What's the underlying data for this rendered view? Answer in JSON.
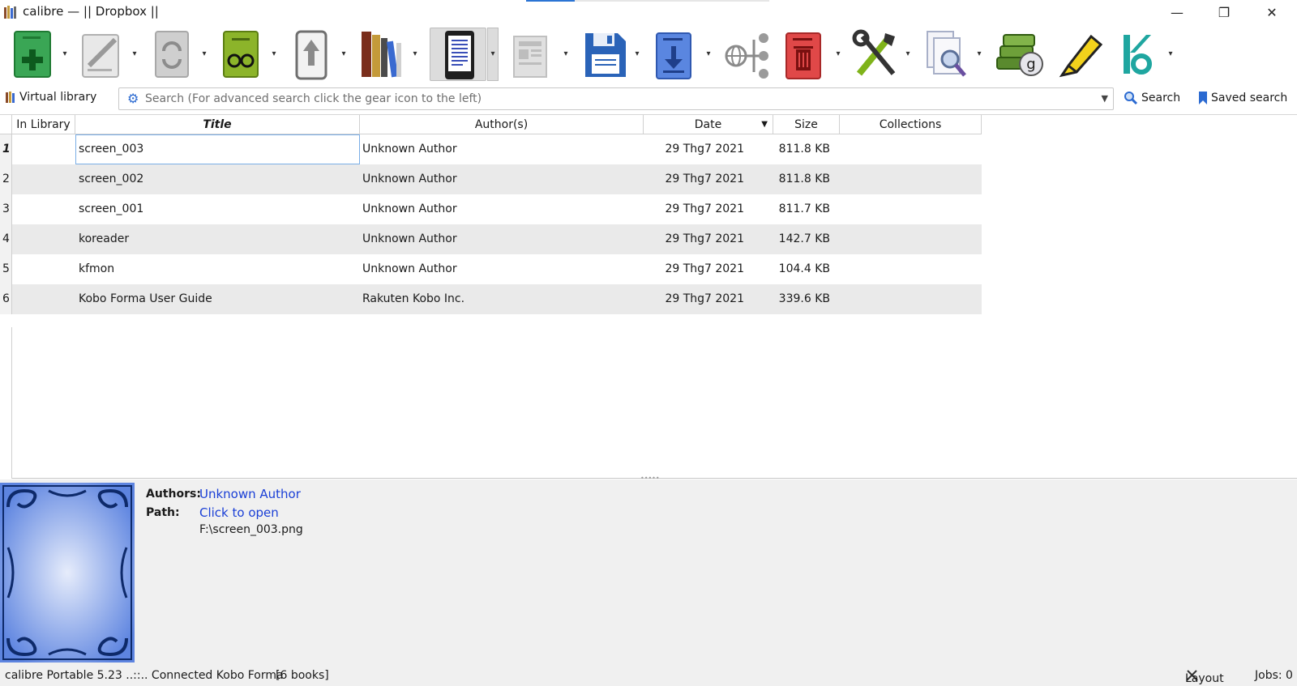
{
  "window": {
    "title": "calibre — || Dropbox ||",
    "minimize_glyph": "—",
    "restore_glyph": "❐",
    "close_glyph": "✕"
  },
  "toolbar": {
    "items": [
      {
        "name": "add-books",
        "icon": "add-book-icon",
        "color": "#3aa655",
        "has_dropdown": true
      },
      {
        "name": "edit-metadata",
        "icon": "edit-metadata-icon",
        "color": "#bdbdbd",
        "has_dropdown": true
      },
      {
        "name": "convert-books",
        "icon": "convert-icon",
        "color": "#bdbdbd",
        "has_dropdown": true
      },
      {
        "name": "view",
        "icon": "view-book-icon",
        "color": "#7fa824",
        "has_dropdown": true
      },
      {
        "name": "send-to-device",
        "icon": "send-to-device-icon",
        "color": "#9a9a9a",
        "has_dropdown": true
      },
      {
        "name": "calibre-library",
        "icon": "library-icon",
        "color": "#7a2e1c",
        "has_dropdown": true
      },
      {
        "name": "device",
        "icon": "device-icon",
        "color": "#222222",
        "has_dropdown": true,
        "active": true
      },
      {
        "name": "fetch-news",
        "icon": "news-icon",
        "color": "#c8c8c8",
        "has_dropdown": true
      },
      {
        "name": "save-to-disk",
        "icon": "save-icon",
        "color": "#2a63b8",
        "has_dropdown": true
      },
      {
        "name": "get-books",
        "icon": "get-books-icon",
        "color": "#3b6fd0",
        "has_dropdown": true
      },
      {
        "name": "connect-share",
        "icon": "connect-share-icon",
        "color": "#9a9a9a",
        "has_dropdown": false
      },
      {
        "name": "remove-books",
        "icon": "trash-icon",
        "color": "#d23a3a",
        "has_dropdown": true
      },
      {
        "name": "preferences",
        "icon": "tools-icon",
        "color": "#333333",
        "has_dropdown": true
      },
      {
        "name": "find-duplicates",
        "icon": "find-icon",
        "color": "#7b8fb8",
        "has_dropdown": true
      },
      {
        "name": "goodreads",
        "icon": "goodreads-icon",
        "color": "#5a8a2e",
        "has_dropdown": false
      },
      {
        "name": "annotations",
        "icon": "highlighter-icon",
        "color": "#f3d21c",
        "has_dropdown": false
      },
      {
        "name": "kobo-utilities",
        "icon": "kobo-icon",
        "color": "#1fa6a0",
        "has_dropdown": true
      }
    ]
  },
  "search": {
    "virtual_library_label": "Virtual library",
    "placeholder": "Search (For advanced search click the gear icon to the left)",
    "search_label": "Search",
    "saved_search_label": "Saved search"
  },
  "columns": {
    "in_library": "In Library",
    "title": "Title",
    "authors": "Author(s)",
    "date": "Date",
    "size": "Size",
    "collections": "Collections",
    "sort_glyph": "▼"
  },
  "books": [
    {
      "num": "1",
      "title": "screen_003",
      "author": "Unknown Author",
      "date": "29 Thg7 2021",
      "size": "811.8 KB"
    },
    {
      "num": "2",
      "title": "screen_002",
      "author": "Unknown Author",
      "date": "29 Thg7 2021",
      "size": "811.8 KB"
    },
    {
      "num": "3",
      "title": "screen_001",
      "author": "Unknown Author",
      "date": "29 Thg7 2021",
      "size": "811.7 KB"
    },
    {
      "num": "4",
      "title": "koreader",
      "author": "Unknown Author",
      "date": "29 Thg7 2021",
      "size": "142.7 KB"
    },
    {
      "num": "5",
      "title": "kfmon",
      "author": "Unknown Author",
      "date": "29 Thg7 2021",
      "size": "104.4 KB"
    },
    {
      "num": "6",
      "title": "Kobo Forma User Guide",
      "author": "Rakuten Kobo Inc.",
      "date": "29 Thg7 2021",
      "size": "339.6 KB"
    }
  ],
  "details": {
    "authors_label": "Authors:",
    "authors_value": "Unknown Author",
    "path_label": "Path:",
    "path_link": "Click to open",
    "path_value": "F:\\screen_003.png"
  },
  "status": {
    "left": "calibre Portable 5.23 ..::.. Connected Kobo Forma",
    "books": "[6 books]",
    "layout": "Layout",
    "jobs": "Jobs: 0"
  }
}
